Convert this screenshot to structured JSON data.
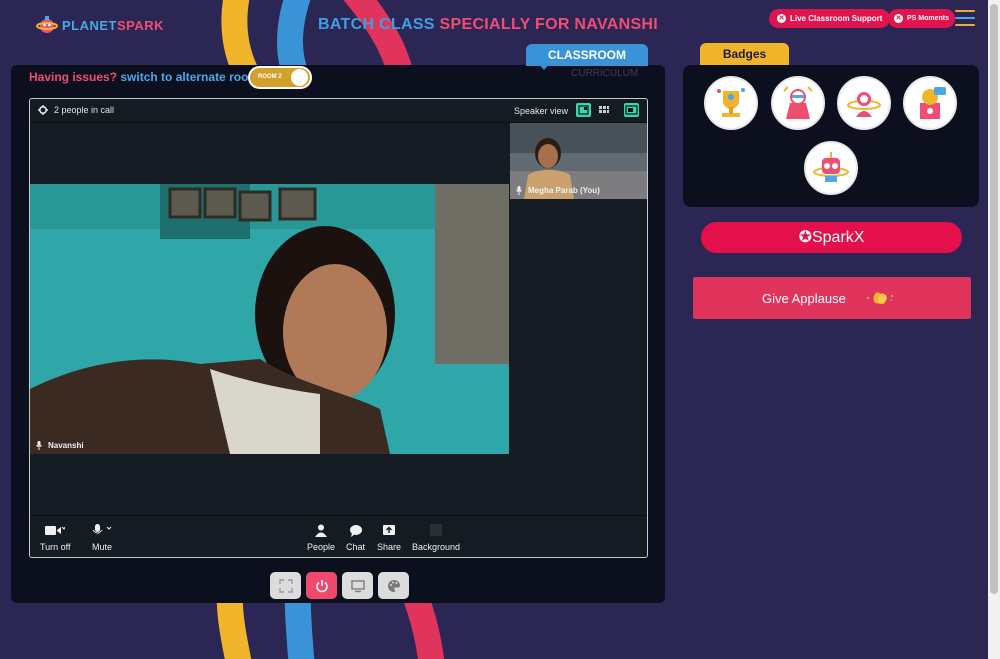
{
  "header": {
    "logo_part1": "PLANET",
    "logo_part2": "SPARK",
    "title_part1": "BATCH CLASS",
    "title_part2": "SPECIALLY FOR NAVANSHI",
    "live_support_label": "Live Classroom Support",
    "ps_moments_label": "PS Moments"
  },
  "tabs": {
    "classroom": "CLASSROOM",
    "curriculum": "CURRICULUM"
  },
  "room": {
    "issue_prefix": "Having issues?",
    "issue_link": "switch to alternate room",
    "toggle_label": "ROOM 2"
  },
  "call": {
    "people_count": "2 people in call",
    "view_label": "Speaker view",
    "main_participant": "Navanshi",
    "thumb_participant": "Megha Parab (You)",
    "controls": {
      "camera": "Turn off",
      "mic": "Mute",
      "people": "People",
      "chat": "Chat",
      "share": "Share",
      "background": "Background"
    }
  },
  "badges": {
    "title": "Badges",
    "items": [
      "trophy-badge",
      "hero-badge",
      "astronaut-badge",
      "idea-badge",
      "robot-badge"
    ]
  },
  "sparkx_label": "SparkX",
  "applause_label": "Give Applause",
  "colors": {
    "background": "#2b2653",
    "accent_red": "#e3104b",
    "accent_blue": "#3a93d6",
    "accent_yellow": "#f0b52a",
    "panel": "#0c0f1e"
  }
}
